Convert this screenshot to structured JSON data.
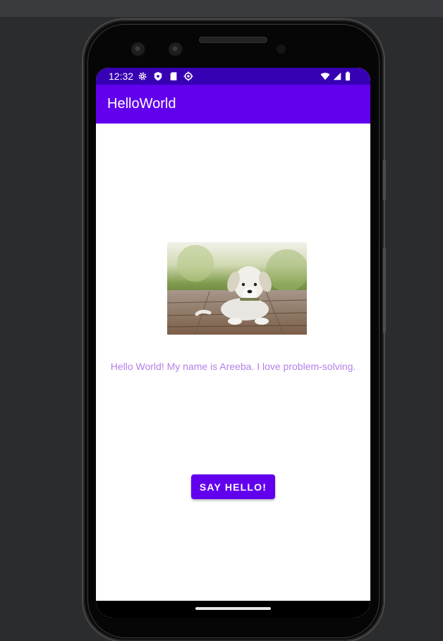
{
  "device": {
    "status_bar": {
      "time": "12:32",
      "left_icons": [
        "gear-icon",
        "shield-icon",
        "sd-card-icon",
        "sync-icon"
      ],
      "right_icons": [
        "wifi-icon",
        "signal-icon",
        "battery-icon"
      ]
    }
  },
  "app": {
    "title": "HelloWorld",
    "colors": {
      "primary": "#6200ee",
      "primary_dark": "#3700b3",
      "text_accent": "#b57ee8"
    },
    "main": {
      "image_alt": "puppy-photo",
      "message": "Hello World! My name is Areeba. I love problem-solving.",
      "button_label": "SAY HELLO!"
    }
  }
}
